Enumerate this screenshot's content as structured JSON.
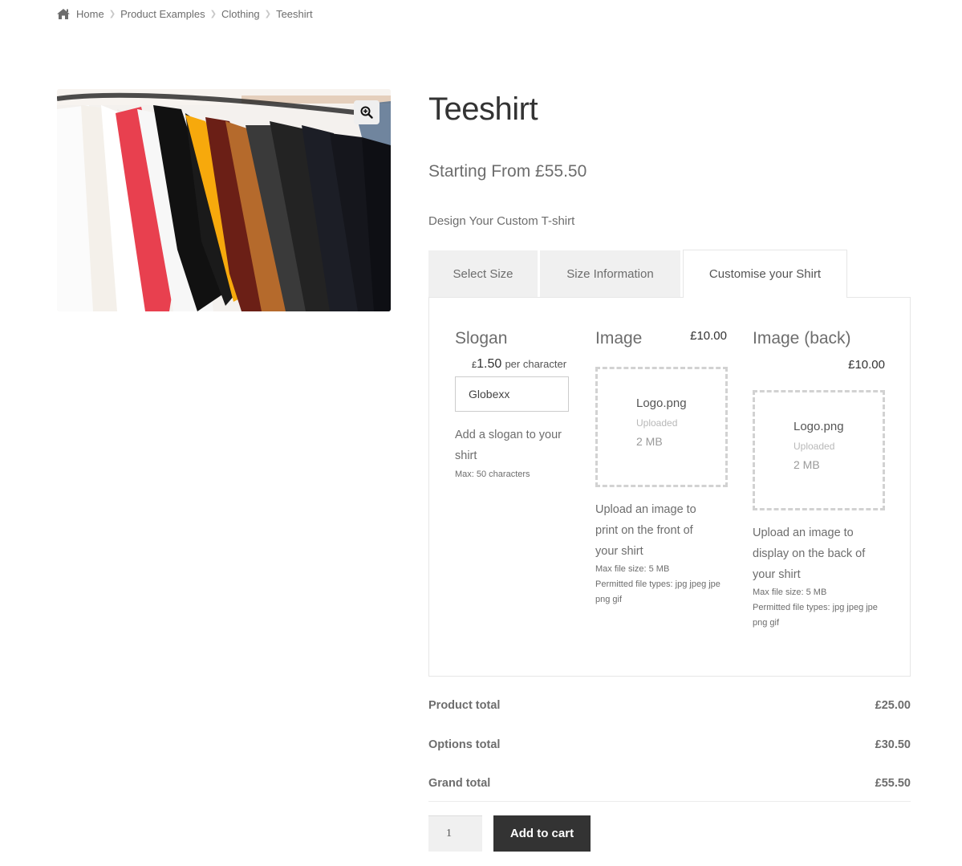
{
  "breadcrumb": {
    "items": [
      "Home",
      "Product Examples",
      "Clothing",
      "Teeshirt"
    ],
    "icon": "home-icon"
  },
  "gallery": {
    "alt": "Teeshirts on hangers",
    "zoom_icon": "zoom-in-icon"
  },
  "product": {
    "title": "Teeshirt",
    "price": "Starting From £55.50",
    "short_description": "Design Your Custom T-shirt"
  },
  "tabs": [
    {
      "label": "Select Size",
      "active": false
    },
    {
      "label": "Size Information",
      "active": false
    },
    {
      "label": "Customise your Shirt",
      "active": true
    }
  ],
  "fields": {
    "slogan": {
      "title": "Slogan",
      "price": "£1.50",
      "price_unit": "per character",
      "value": "Globexx",
      "description": "Add a slogan to your shirt",
      "max": "Max: 50 characters"
    },
    "image_front": {
      "title": "Image",
      "price": "£10.00",
      "file_name": "Logo.png",
      "file_status": "Uploaded",
      "file_size": "2 MB",
      "description": "Upload an image to print on the front of your shirt",
      "max_size": "Max file size: 5 MB",
      "types": "Permitted file types: jpg jpeg jpe png gif"
    },
    "image_back": {
      "title": "Image (back)",
      "price": "£10.00",
      "file_name": "Logo.png",
      "file_status": "Uploaded",
      "file_size": "2 MB",
      "description": "Upload an image to display on the back of your shirt",
      "max_size": "Max file size: 5 MB",
      "types": "Permitted file types: jpg jpeg jpe png gif"
    }
  },
  "totals": [
    {
      "label": "Product total",
      "value": "£25.00"
    },
    {
      "label": "Options total",
      "value": "£30.50"
    },
    {
      "label": "Grand total",
      "value": "£55.50"
    }
  ],
  "cart": {
    "quantity": "1",
    "add_to_cart_label": "Add to cart"
  },
  "colors": {
    "text": "#6d6d6d",
    "heading": "#333333",
    "button_bg": "#333333",
    "tab_bg": "#f0f0f0"
  }
}
